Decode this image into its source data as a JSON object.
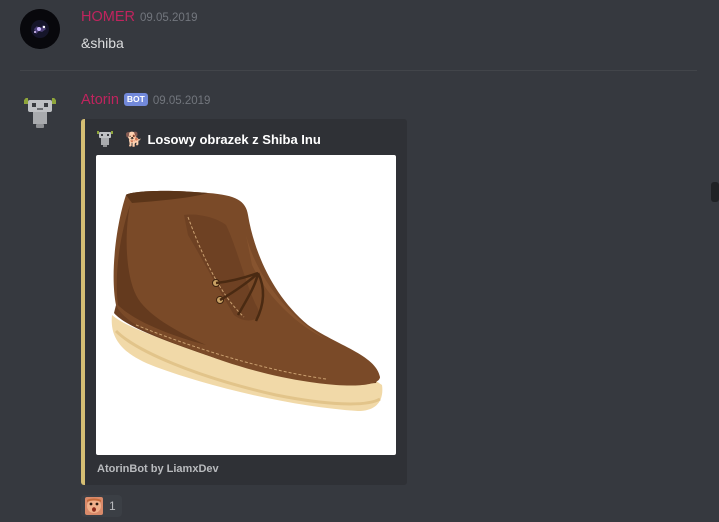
{
  "messages": [
    {
      "author": "HOMER",
      "author_color": "#c0245e",
      "timestamp": "09.05.2019",
      "text": "&shiba",
      "avatar_icon": "galaxy-avatar"
    },
    {
      "author": "Atorin",
      "author_color": "#c0245e",
      "bot_tag": "BOT",
      "timestamp": "09.05.2019",
      "avatar_icon": "robot-avatar",
      "embed": {
        "accent_color": "#d5be73",
        "author_icon": "robot-icon",
        "title_emoji": "🐕",
        "title": "Losowy obrazek z Shiba Inu",
        "image": "brown-leather-chukka-boot",
        "footer": "AtorinBot by LiamxDev"
      },
      "reaction": {
        "emoji": "surprised-face-emoji",
        "count": "1"
      }
    }
  ],
  "colors": {
    "background": "#36393f",
    "embed_background": "#2f3136",
    "bot_tag": "#7289da",
    "timestamp": "#72767d"
  }
}
